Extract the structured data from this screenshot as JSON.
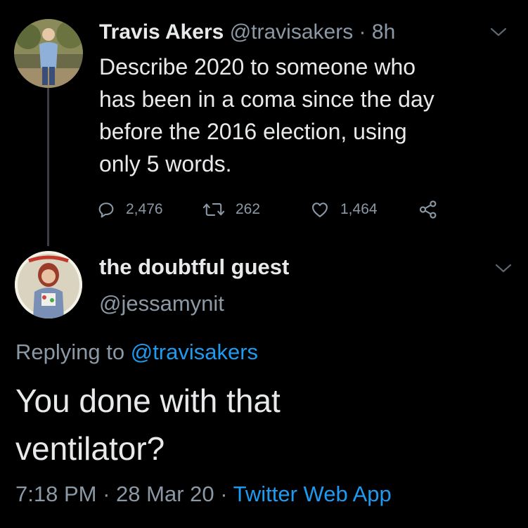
{
  "tweet": {
    "author_name": "Travis Akers",
    "author_handle": "@travisakers",
    "separator": "·",
    "time": "8h",
    "text_lines": [
      "Describe 2020 to someone who",
      "has been in a coma since the day",
      "before the 2016 election, using",
      "only 5 words."
    ],
    "replies": "2,476",
    "retweets": "262",
    "likes": "1,464"
  },
  "reply": {
    "author_name": "the doubtful guest",
    "author_handle": "@jessamynit",
    "replying_prefix": "Replying to",
    "replying_to": "@travisakers",
    "text_lines": [
      "You done with that",
      "ventilator?"
    ],
    "time": "7:18 PM",
    "separator": "·",
    "date": "28 Mar 20",
    "separator2": "·",
    "source": "Twitter Web App"
  },
  "icons": {
    "reply": "reply-icon",
    "retweet": "retweet-icon",
    "like": "heart-icon",
    "share": "share-icon",
    "menu": "chevron-down-icon"
  },
  "colors": {
    "background": "#000000",
    "text": "#e7e9ea",
    "secondary": "#8b98a5",
    "link": "#1d9bf0"
  }
}
